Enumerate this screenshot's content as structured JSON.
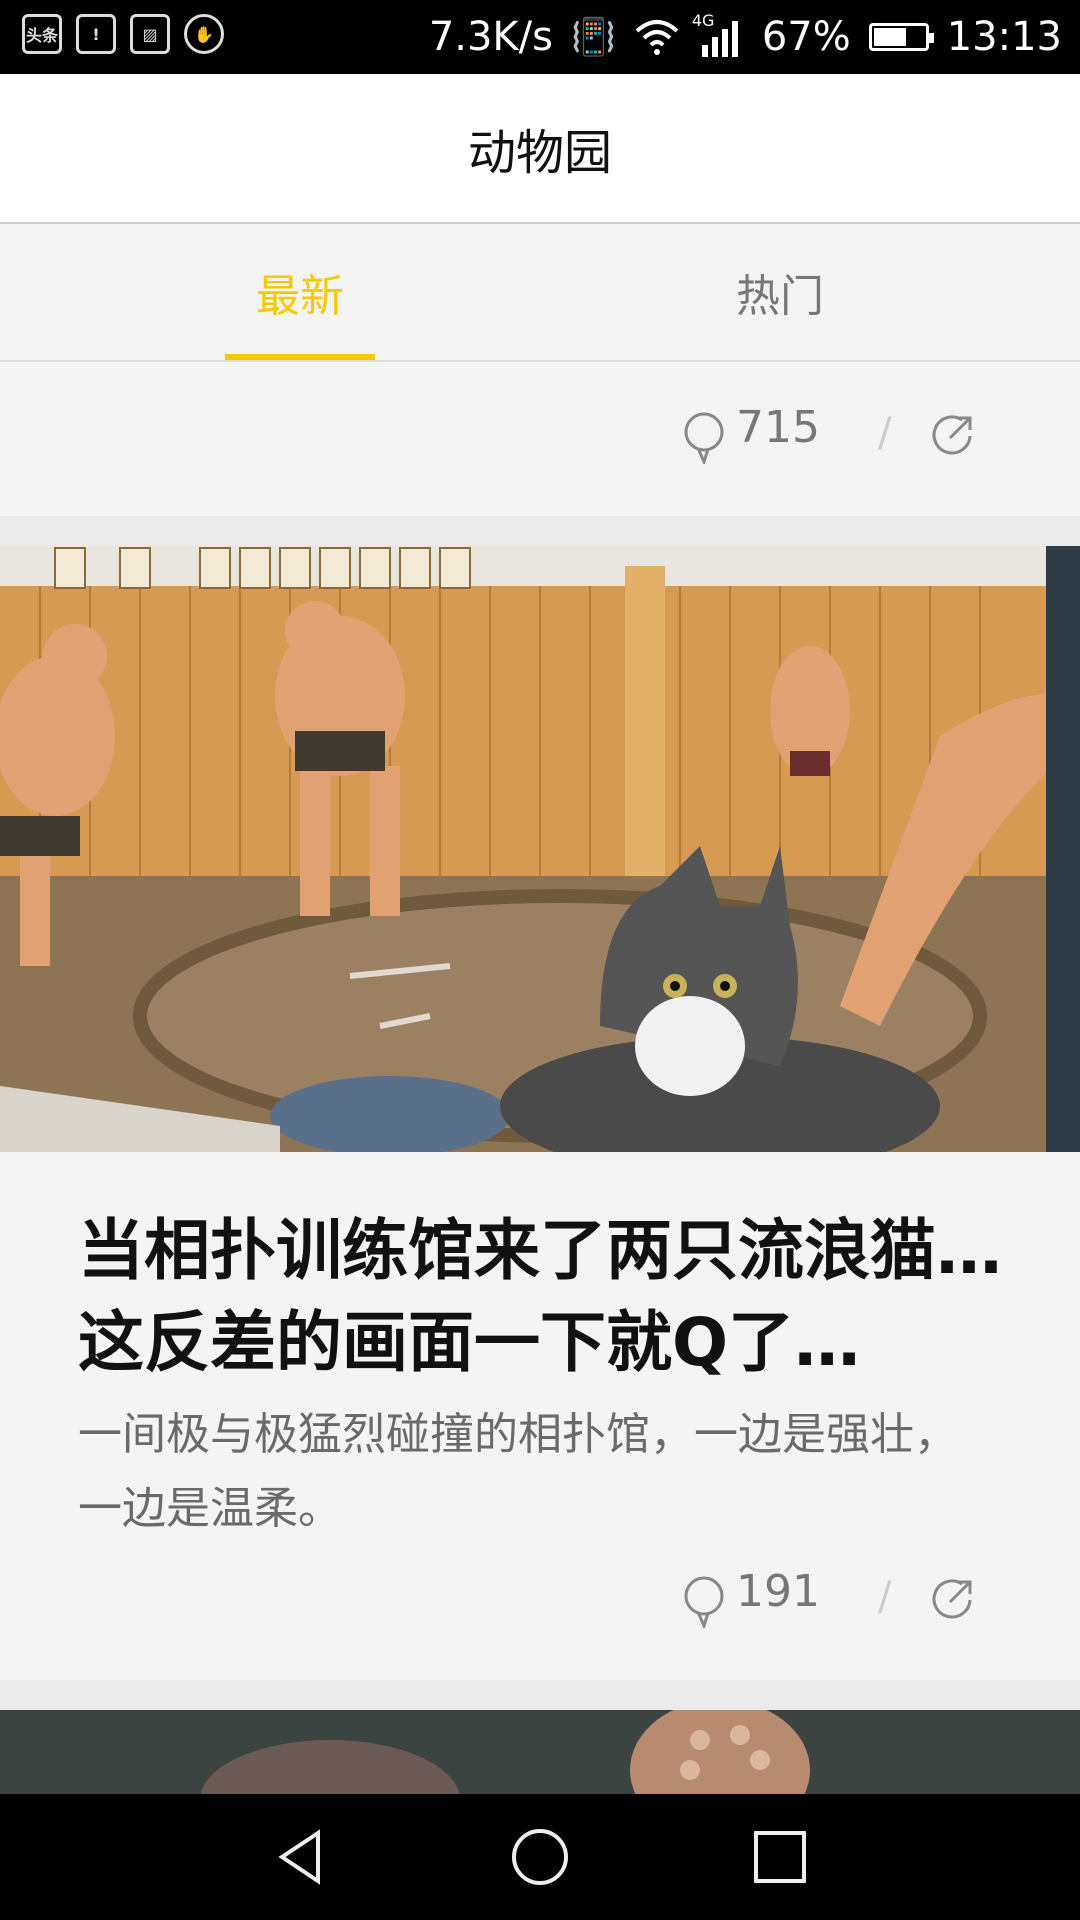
{
  "status_bar": {
    "left_icons": [
      "app-toutiao-icon",
      "battery-alert-icon",
      "image-icon",
      "hand-icon"
    ],
    "net_speed": "7.3K/s",
    "network": "4G",
    "battery": "67%",
    "battery_level": 0.67,
    "time": "13:13"
  },
  "header": {
    "title": "动物园"
  },
  "tabs": [
    {
      "label": "最新",
      "active": true
    },
    {
      "label": "热门",
      "active": false
    }
  ],
  "accent_color": "#f6c800",
  "feed": {
    "prev_item": {
      "comment_count": "715"
    },
    "article": {
      "title": "当相扑训练馆来了两只流浪猫…这反差的画面一下就Q了…",
      "summary": "一间极与极猛烈碰撞的相扑馆，一边是强壮，一边是温柔。",
      "comment_count": "191"
    }
  },
  "nav": [
    "back-icon",
    "home-icon",
    "recents-icon"
  ]
}
